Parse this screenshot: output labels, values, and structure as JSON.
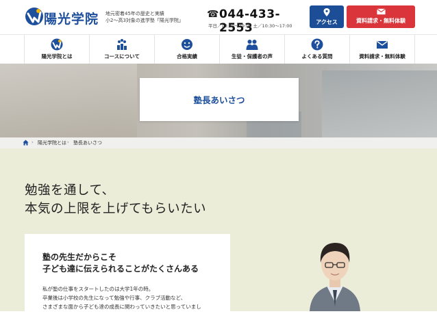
{
  "header": {
    "logo_text": "陽光学院",
    "tagline_line1": "地元密着45年の歴史と実績",
    "tagline_line2": "小2〜高3対象の進学塾「陽光学院」",
    "phone": "044-433-2553",
    "hours": "平日／13:00〜19:00 土／10:30〜17:00",
    "access_label": "アクセス",
    "request_label": "資料請求・無料体験"
  },
  "nav": {
    "items": [
      {
        "label": "陽光学院とは",
        "icon": "logo-icon"
      },
      {
        "label": "コースについて",
        "icon": "podium-icon"
      },
      {
        "label": "合格実績",
        "icon": "smile-icon"
      },
      {
        "label": "生徒・保護者の声",
        "icon": "people-icon"
      },
      {
        "label": "よくある質問",
        "icon": "question-icon"
      },
      {
        "label": "資料請求・無料体験",
        "icon": "mail-icon"
      }
    ]
  },
  "hero": {
    "title": "塾長あいさつ"
  },
  "breadcrumb": {
    "items": [
      "陽光学院とは",
      "塾長あいさつ"
    ]
  },
  "main": {
    "heading_line1": "勉強を通して、",
    "heading_line2": "本気の上限を上げてもらいたい",
    "card_title_line1": "塾の先生だからこそ",
    "card_title_line2": "子ども達に伝えられることがたくさんある",
    "card_body_line1": "私が塾の仕事をスタートしたのは大学1年の時。",
    "card_body_line2": "卒業後は小学校の先生になって勉強や行事、クラブ活動など、",
    "card_body_line3": "さまざまな面から子ども達の成長に関わっていきたいと思っていまし"
  },
  "colors": {
    "brand_blue": "#1d4f9c",
    "access_button": "#1c4e97",
    "request_button": "#d9353a",
    "main_background": "#ecedd9"
  }
}
